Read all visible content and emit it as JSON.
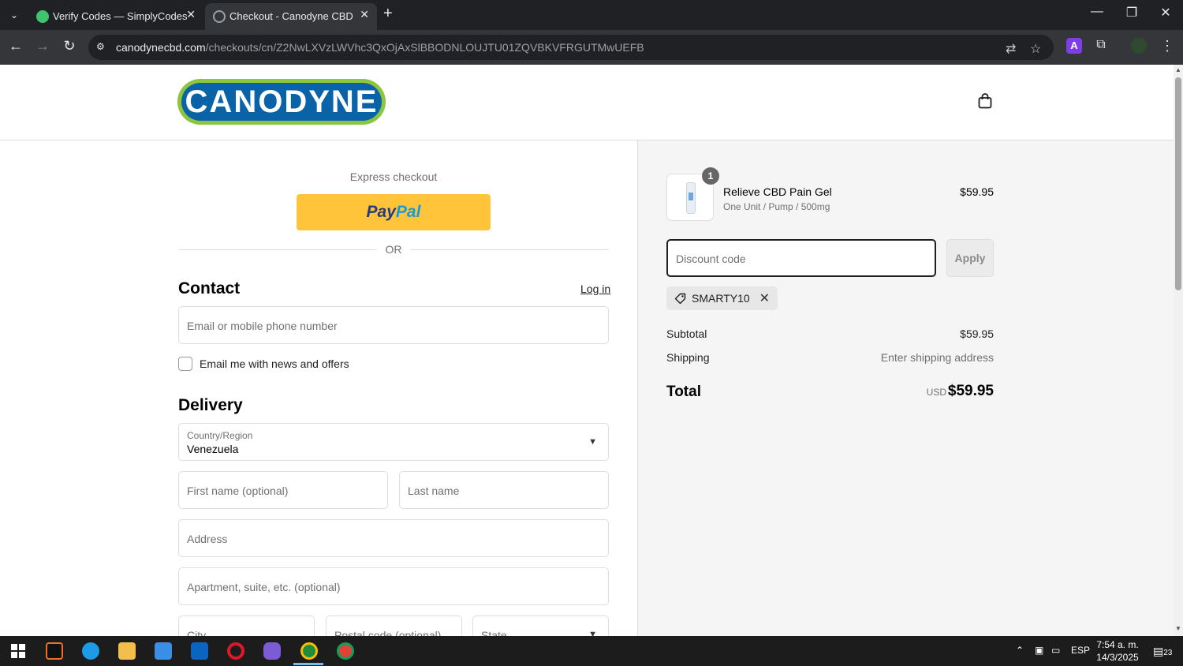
{
  "browser": {
    "tabs": [
      {
        "title": "Verify Codes — SimplyCodes",
        "active": false
      },
      {
        "title": "Checkout - Canodyne CBD",
        "active": true
      }
    ],
    "url_domain": "canodynecbd.com",
    "url_path": "/checkouts/cn/Z2NwLXVzLWVhc3QxOjAxSlBBODNLOUJTU01ZQVBKVFRGUTMwUEFB"
  },
  "store": {
    "logo_text": "CANODYNE"
  },
  "checkout": {
    "express_label": "Express checkout",
    "paypal_pay": "Pay",
    "paypal_pal": "Pal",
    "or_label": "OR",
    "contact": {
      "title": "Contact",
      "login_label": "Log in",
      "email_placeholder": "Email or mobile phone number",
      "newsletter_label": "Email me with news and offers"
    },
    "delivery": {
      "title": "Delivery",
      "country_label": "Country/Region",
      "country_value": "Venezuela",
      "first_name_placeholder": "First name (optional)",
      "last_name_placeholder": "Last name",
      "address_placeholder": "Address",
      "apartment_placeholder": "Apartment, suite, etc. (optional)",
      "city_placeholder": "City",
      "postal_placeholder": "Postal code (optional)",
      "state_placeholder": "State"
    }
  },
  "summary": {
    "item": {
      "quantity": "1",
      "name": "Relieve CBD Pain Gel",
      "variant": "One Unit / Pump / 500mg",
      "price": "$59.95"
    },
    "discount_placeholder": "Discount code",
    "apply_label": "Apply",
    "applied_code": "SMARTY10",
    "subtotal_label": "Subtotal",
    "subtotal_value": "$59.95",
    "shipping_label": "Shipping",
    "shipping_value": "Enter shipping address",
    "total_label": "Total",
    "total_currency": "USD",
    "total_value": "$59.95"
  },
  "taskbar": {
    "language": "ESP",
    "time": "7:54 a. m.",
    "date": "14/3/2025",
    "notifications": "23"
  },
  "colors": {
    "paypal_yellow": "#ffc439",
    "logo_green": "#8cc63f",
    "logo_blue": "#0a63a7"
  }
}
